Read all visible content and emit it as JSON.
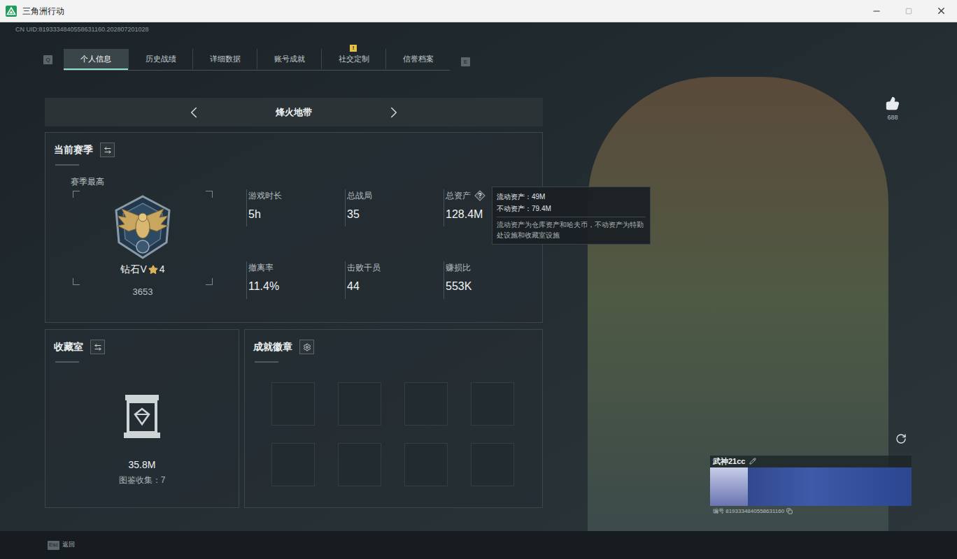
{
  "window": {
    "title": "三角洲行动"
  },
  "uid": "CN UID:8193334840558631160.202807201028",
  "tabs": {
    "prev_key": "Q",
    "next_key": "E",
    "items": [
      {
        "label": "个人信息",
        "selected": true
      },
      {
        "label": "历史战绩",
        "selected": false
      },
      {
        "label": "详细数据",
        "selected": false
      },
      {
        "label": "账号成就",
        "selected": false
      },
      {
        "label": "社交定制",
        "selected": false,
        "badge": "!"
      },
      {
        "label": "信誉档案",
        "selected": false
      }
    ]
  },
  "mode": {
    "label": "烽火地带"
  },
  "season": {
    "title": "当前赛季",
    "best_label": "赛季最高",
    "rank": "钻石V",
    "rank_stars": "4",
    "score": "3653",
    "stats": [
      {
        "label": "游戏时长",
        "value": "5h",
        "help": false
      },
      {
        "label": "总战局",
        "value": "35",
        "help": false
      },
      {
        "label": "总资产",
        "value": "128.4M",
        "help": true
      },
      {
        "label": "撤离率",
        "value": "11.4%",
        "help": false
      },
      {
        "label": "击败干员",
        "value": "44",
        "help": false
      },
      {
        "label": "赚损比",
        "value": "553K",
        "help": false
      }
    ],
    "tooltip": {
      "lines": [
        "流动资产：49M",
        "不动资产：79.4M"
      ],
      "note": "流动资产为仓库资产和哈夫币，不动资产为特勤处设施和收藏室设施"
    }
  },
  "collection": {
    "title": "收藏室",
    "value": "35.8M",
    "caption": "图鉴收集：7"
  },
  "achievements": {
    "title": "成就徽章",
    "slots": [
      {
        "filled": false
      },
      {
        "filled": false
      },
      {
        "filled": false
      },
      {
        "filled": false
      },
      {
        "filled": false
      },
      {
        "filled": false
      },
      {
        "filled": false
      },
      {
        "filled": false
      }
    ]
  },
  "likes": "688",
  "profile": {
    "name": "武神21cc",
    "id": "编号 8193334840558631160"
  },
  "footer": {
    "key": "Esc",
    "label": "返回"
  }
}
